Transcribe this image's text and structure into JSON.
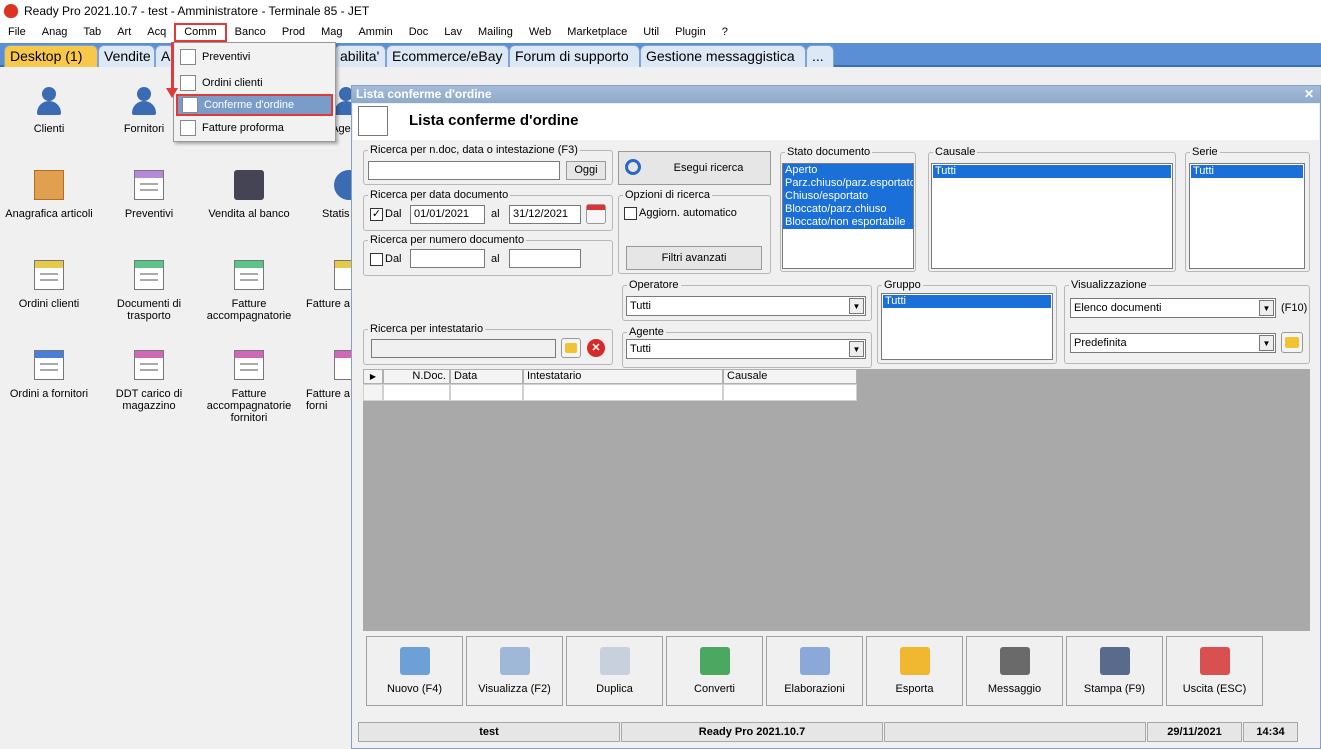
{
  "window_title": "Ready Pro 2021.10.7 - test - Amministratore - Terminale 85 - JET",
  "menu": [
    "File",
    "Anag",
    "Tab",
    "Art",
    "Acq",
    "Comm",
    "Banco",
    "Prod",
    "Mag",
    "Ammin",
    "Doc",
    "Lav",
    "Mailing",
    "Web",
    "Marketplace",
    "Util",
    "Plugin",
    "?"
  ],
  "tabs": [
    "Desktop (1)",
    "Vendite",
    "A",
    "abilita'",
    "Ecommerce/eBay",
    "Forum di supporto",
    "Gestione messaggistica",
    "..."
  ],
  "desktop": {
    "clienti": "Clienti",
    "fornitori": "Fornitori",
    "age": "Age",
    "anagrafica": "Anagrafica articoli",
    "preventivi": "Preventivi",
    "vendita": "Vendita al banco",
    "statis": "Statis",
    "ordini_clienti": "Ordini clienti",
    "documenti_trasporto": "Documenti di trasporto",
    "fatture_accomp": "Fatture accompagnatorie",
    "fatture_a": "Fatture a",
    "ordini_fornitori": "Ordini a fornitori",
    "ddt_carico": "DDT carico di magazzino",
    "fatture_accomp_forn": "Fatture accompagnatorie fornitori",
    "fatture_forn": "Fatture a forni"
  },
  "comm_menu": [
    "Preventivi",
    "Ordini clienti",
    "Conferme d'ordine",
    "Fatture proforma"
  ],
  "list_window": {
    "title": "Lista conferme d'ordine",
    "header": "Lista conferme d'ordine",
    "search_label": "Ricerca per n.doc, data o intestazione (F3)",
    "oggi": "Oggi",
    "esegui": "Esegui ricerca",
    "date_group": "Ricerca per data documento",
    "dal": "Dal",
    "al": "al",
    "date_from": "01/01/2021",
    "date_to": "31/12/2021",
    "num_group": "Ricerca per numero documento",
    "opzioni": "Opzioni di ricerca",
    "aggiorn": "Aggiorn. automatico",
    "filtri": "Filtri avanzati",
    "stato_label": "Stato documento",
    "stato_items": [
      "Aperto",
      "Parz.chiuso/parz.esportato",
      "Chiuso/esportato",
      "Bloccato/parz.chiuso",
      "Bloccato/non esportabile"
    ],
    "causale_label": "Causale",
    "causale_items": [
      "Tutti"
    ],
    "serie_label": "Serie",
    "serie_items": [
      "Tutti"
    ],
    "operatore_label": "Operatore",
    "operatore_value": "Tutti",
    "gruppo_label": "Gruppo",
    "gruppo_items": [
      "Tutti"
    ],
    "visualizzazione_label": "Visualizzazione",
    "visual_value": "Elenco documenti",
    "f10": "(F10)",
    "predefinita": "Predefinita",
    "intestatario_label": "Ricerca per intestatario",
    "agente_label": "Agente",
    "agente_value": "Tutti",
    "columns": [
      "N.Doc.",
      "Data",
      "Intestatario",
      "Causale"
    ],
    "buttons": [
      "Nuovo (F4)",
      "Visualizza (F2)",
      "Duplica",
      "Converti",
      "Elaborazioni",
      "Esporta",
      "Messaggio",
      "Stampa (F9)",
      "Uscita (ESC)"
    ],
    "status": {
      "user": "test",
      "version": "Ready Pro 2021.10.7",
      "date": "29/11/2021",
      "time": "14:34"
    }
  }
}
